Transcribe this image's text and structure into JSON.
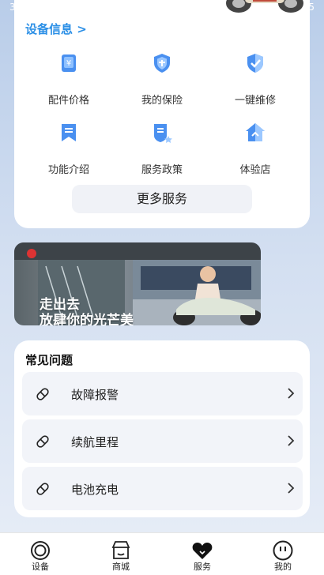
{
  "status_bar": {
    "time": "3",
    "battery": "5"
  },
  "device": {
    "info_link": "设备信息 >"
  },
  "services": [
    {
      "label": "配件价格",
      "icon": "price-tag-icon"
    },
    {
      "label": "我的保险",
      "icon": "insurance-shield-icon"
    },
    {
      "label": "一键维修",
      "icon": "repair-shield-icon"
    },
    {
      "label": "功能介绍",
      "icon": "bookmark-icon"
    },
    {
      "label": "服务政策",
      "icon": "policy-doc-icon"
    },
    {
      "label": "体验店",
      "icon": "store-house-icon"
    }
  ],
  "more_services": "更多服务",
  "banner": {
    "line1": "走出去",
    "line2": "放肆你的光芒美"
  },
  "faq": {
    "title": "常见问题",
    "items": [
      {
        "label": "故障报警",
        "icon": "capsule-icon"
      },
      {
        "label": "续航里程",
        "icon": "capsule-icon"
      },
      {
        "label": "电池充电",
        "icon": "capsule-icon"
      }
    ]
  },
  "tabs": [
    {
      "label": "设备",
      "icon": "device-ring-icon"
    },
    {
      "label": "商城",
      "icon": "shop-icon"
    },
    {
      "label": "服务",
      "icon": "heart-icon",
      "active": true
    },
    {
      "label": "我的",
      "icon": "face-icon"
    }
  ],
  "colors": {
    "accent": "#2b8fe6",
    "icon_blue": "#4a90f0",
    "page_bg": "#c7d7ee"
  }
}
